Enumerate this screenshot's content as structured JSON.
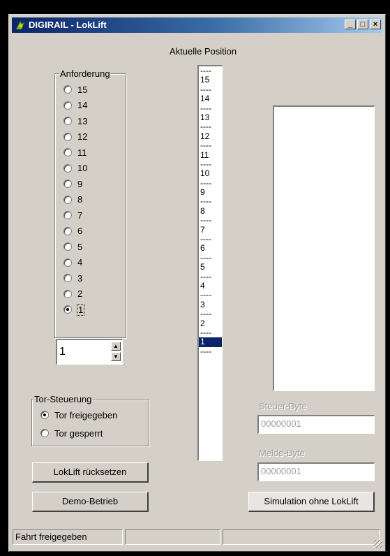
{
  "window": {
    "title": "DIGIRAIL - LokLift",
    "controls": {
      "minimize": "_",
      "maximize": "□",
      "close": "×"
    },
    "icon": "train-logo-icon"
  },
  "position_label": "Aktuelle Position",
  "anforderung": {
    "legend": "Anforderung",
    "options": [
      "15",
      "14",
      "13",
      "12",
      "11",
      "10",
      "9",
      "8",
      "7",
      "6",
      "5",
      "4",
      "3",
      "2",
      "1"
    ],
    "selected": "1",
    "spinner_value": "1"
  },
  "tor": {
    "legend": "Tor-Steuerung",
    "options": [
      "Tor freigegeben",
      "Tor gesperrt"
    ],
    "selected": "Tor freigegeben"
  },
  "position_list": {
    "items": [
      "----",
      "15",
      "----",
      "14",
      "----",
      "13",
      "----",
      "12",
      "----",
      "11",
      "----",
      "10",
      "----",
      "9",
      "----",
      "8",
      "----",
      "7",
      "----",
      "6",
      "----",
      "5",
      "----",
      "4",
      "----",
      "3",
      "----",
      "2",
      "----",
      "1",
      "----"
    ],
    "selected": "1"
  },
  "buttons": {
    "reset": "LokLift rücksetzen",
    "demo": "Demo-Betrieb",
    "simulation": "Simulation ohne LokLift"
  },
  "steuer_byte": {
    "label": "Steuer-Byte",
    "value": "00000001"
  },
  "melde_byte": {
    "label": "Melde-Byte",
    "value": "00000001"
  },
  "status": {
    "panel1": "Fahrt freigegeben",
    "panel2": "",
    "panel3": ""
  },
  "colors": {
    "titlebar": "#0a246a",
    "selection": "#0a246a",
    "face": "#d4d0c8"
  }
}
